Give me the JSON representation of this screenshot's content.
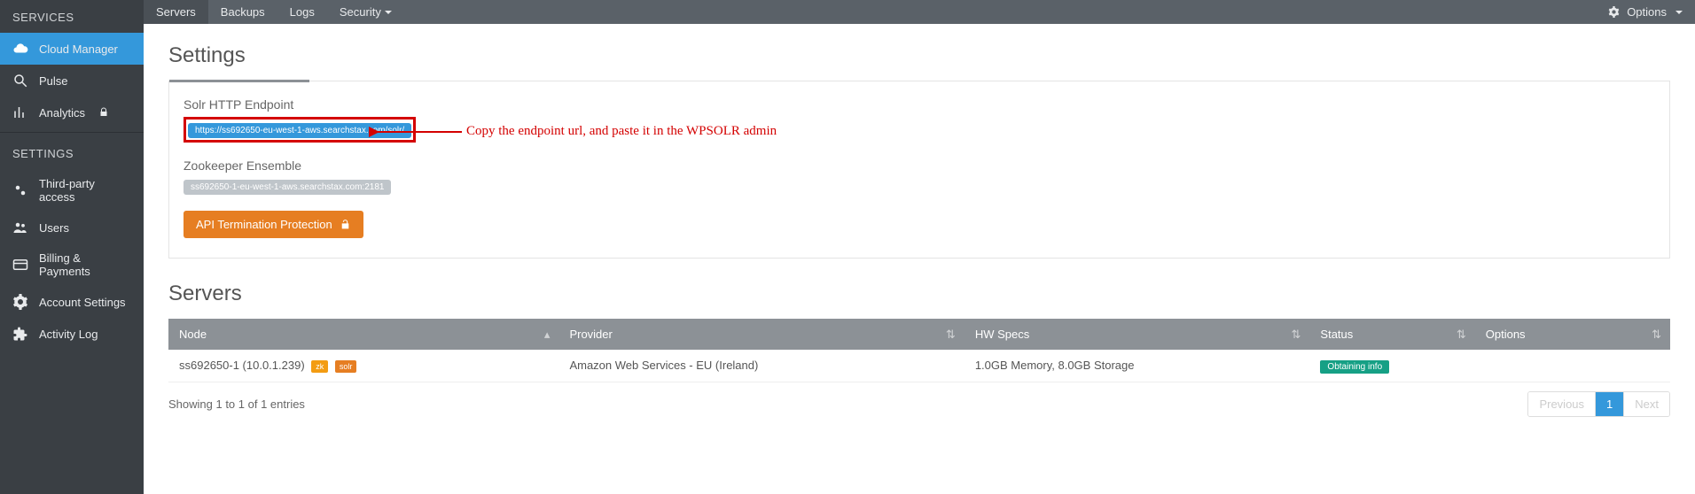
{
  "sidebar": {
    "services_title": "SERVICES",
    "settings_title": "SETTINGS",
    "items_services": [
      {
        "label": "Cloud Manager"
      },
      {
        "label": "Pulse"
      },
      {
        "label": "Analytics"
      }
    ],
    "items_settings": [
      {
        "label": "Third-party access"
      },
      {
        "label": "Users"
      },
      {
        "label": "Billing & Payments"
      },
      {
        "label": "Account Settings"
      },
      {
        "label": "Activity Log"
      }
    ]
  },
  "topbar": {
    "tabs": [
      {
        "label": "Servers"
      },
      {
        "label": "Backups"
      },
      {
        "label": "Logs"
      },
      {
        "label": "Security"
      }
    ],
    "options_label": "Options"
  },
  "settings_section": {
    "title": "Settings",
    "solr_label": "Solr HTTP Endpoint",
    "solr_value": "https://ss692650-eu-west-1-aws.searchstax.com/solr/",
    "zk_label": "Zookeeper Ensemble",
    "zk_value": "ss692650-1-eu-west-1-aws.searchstax.com:2181",
    "api_btn": "API Termination Protection",
    "annotation": "Copy the endpoint url, and paste it in the WPSOLR admin"
  },
  "servers_section": {
    "title": "Servers",
    "columns": [
      "Node",
      "Provider",
      "HW Specs",
      "Status",
      "Options"
    ],
    "row": {
      "node": "ss692650-1 (10.0.1.239)",
      "badge_zk": "zk",
      "badge_solr": "solr",
      "provider": "Amazon Web Services - EU (Ireland)",
      "hw": "1.0GB Memory, 8.0GB Storage",
      "status": "Obtaining info"
    },
    "footer_text": "Showing 1 to 1 of 1 entries",
    "pagination": {
      "prev": "Previous",
      "page": "1",
      "next": "Next"
    }
  }
}
